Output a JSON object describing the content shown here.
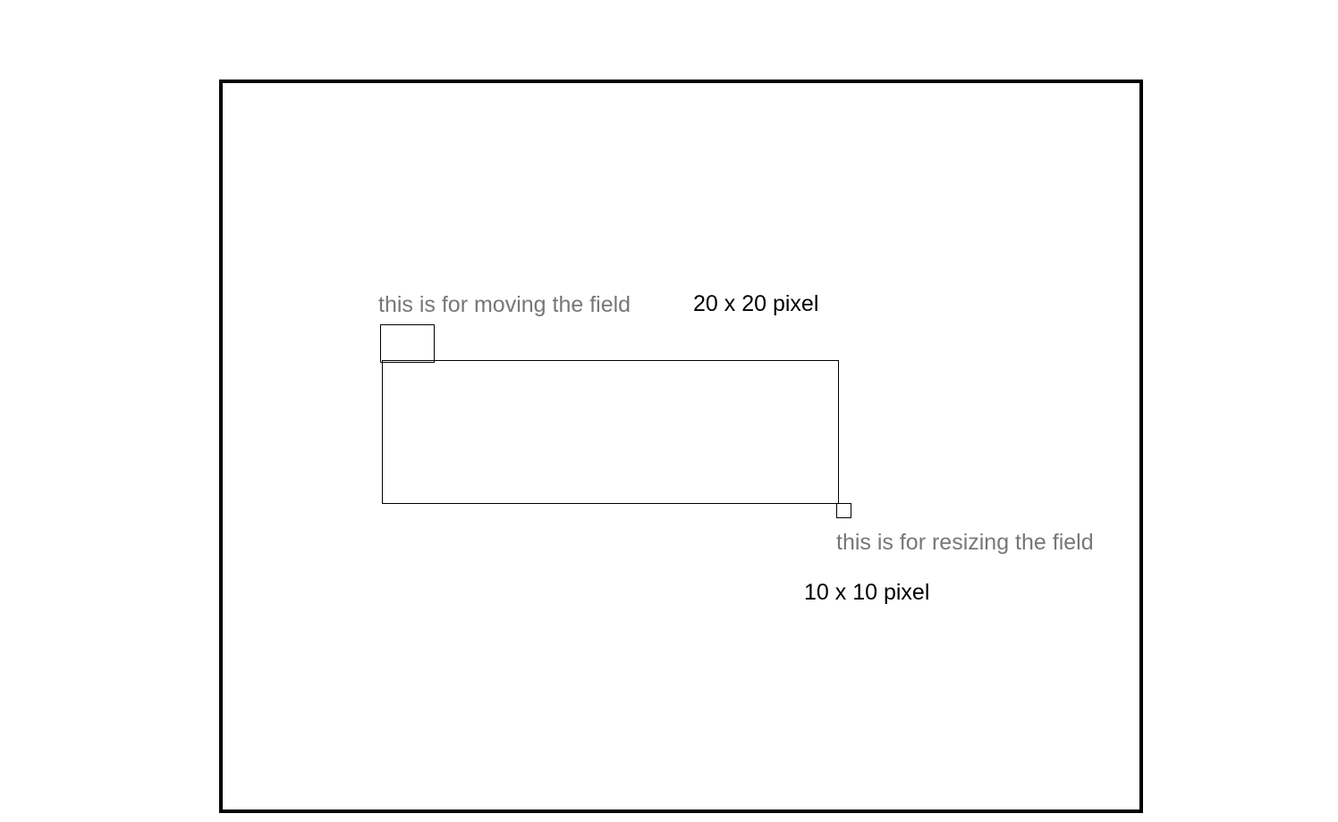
{
  "annotations": {
    "move_label": "this is for moving the field",
    "move_size": "20 x 20 pixel",
    "resize_label": "this is for resizing the field",
    "resize_size": "10 x 10 pixel"
  },
  "colors": {
    "frame": "#000000",
    "annotation_text": "#777777",
    "size_text": "#000000",
    "background": "#ffffff"
  }
}
